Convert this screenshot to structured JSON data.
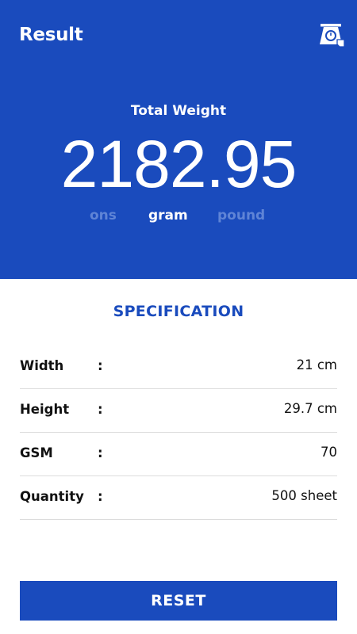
{
  "header": {
    "title": "Result",
    "scale_icon": "kitchen-scale-icon",
    "total_label": "Total Weight",
    "total_value": "2182.95",
    "units": [
      {
        "label": "ons",
        "active": false
      },
      {
        "label": "gram",
        "active": true
      },
      {
        "label": "pound",
        "active": false
      }
    ]
  },
  "spec": {
    "title": "SPECIFICATION",
    "separator": ":",
    "rows": [
      {
        "label": "Width",
        "value": "21 cm"
      },
      {
        "label": "Height",
        "value": "29.7 cm"
      },
      {
        "label": "GSM",
        "value": "70"
      },
      {
        "label": "Quantity",
        "value": "500 sheet"
      }
    ]
  },
  "footer": {
    "reset_label": "RESET"
  },
  "colors": {
    "primary": "#1a4bbd",
    "inactive_unit": "#5f84d6",
    "divider": "#dcdcdc"
  }
}
